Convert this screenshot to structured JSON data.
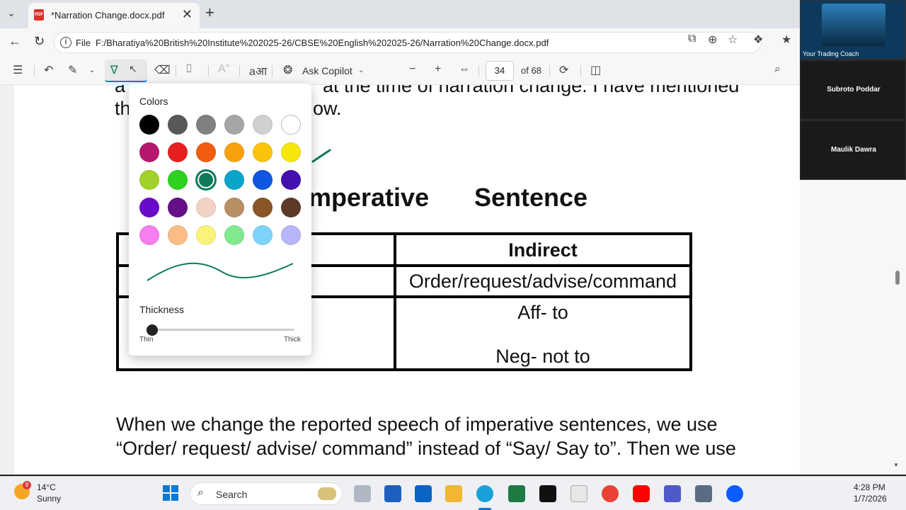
{
  "browser": {
    "tab_title": "*Narration Change.docx.pdf",
    "tab_close": "✕",
    "new_tab": "+",
    "address_prefix": "File",
    "url": "F:/Bharatiya%20British%20Institute%202025-26/CBSE%20English%202025-26/Narration%20Change.docx.pdf"
  },
  "pdf_toolbar": {
    "ask_copilot": "Ask Copilot",
    "page_number": "34",
    "page_count": "of 68"
  },
  "document": {
    "para1_line1": "at the time of narration change. I have mentioned",
    "para1_line1_prefix": "a",
    "para1_line2_prefix": "th",
    "para1_line2_suffix": "ow.",
    "heading_part1": "mperative",
    "heading_part2": "Sentence",
    "table": {
      "header_right": "Indirect",
      "row1_right": "Order/request/advise/command",
      "row2_right_line1": "Aff- to",
      "row2_right_line2": "Neg- not to"
    },
    "para2_line1": "When we change the reported speech of imperative sentences, we use",
    "para2_line2": "“Order/ request/ advise/ command” instead of “Say/ Say to”. Then we use"
  },
  "color_popup": {
    "colors_label": "Colors",
    "thickness_label": "Thickness",
    "thin_label": "Thin",
    "thick_label": "Thick",
    "selected_color": "#0f7a5a",
    "thickness_fraction": 0.0,
    "swatches": [
      [
        "#000000",
        "#595959",
        "#808080",
        "#a6a6a6",
        "#d0d0d0",
        "#ffffff"
      ],
      [
        "#b5176e",
        "#e81f1f",
        "#f25c0f",
        "#f7a20c",
        "#fac40c",
        "#f7e60c"
      ],
      [
        "#a2d12a",
        "#2ed11e",
        "#0f7a5a",
        "#0aa5c9",
        "#0f56e0",
        "#4311b0"
      ],
      [
        "#6a0bc9",
        "#660f86",
        "#f3d3c6",
        "#b98f66",
        "#8a5527",
        "#5c3a27"
      ],
      [
        "#f77ef0",
        "#fbbd85",
        "#faf37a",
        "#83e98f",
        "#7dd3fa",
        "#b7b5fb"
      ]
    ]
  },
  "zoom": {
    "tile1_name": "Your Trading Coach",
    "tile2_name": "Subroto Poddar",
    "tile3_name": "Maulik Dawra"
  },
  "taskbar": {
    "weather_temp": "14°C",
    "weather_desc": "Sunny",
    "weather_badge": "9",
    "search_label": "Search",
    "time": "4:28 PM",
    "date": "1/7/2026"
  }
}
